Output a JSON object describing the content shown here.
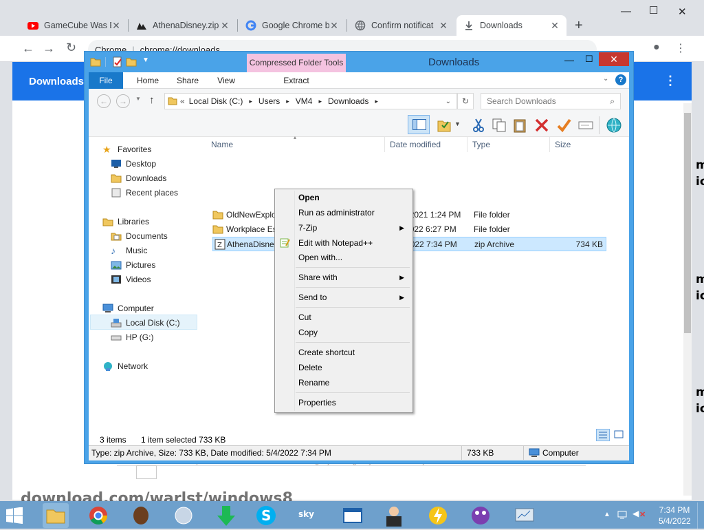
{
  "chrome": {
    "tabs": [
      {
        "label": "GameCube Was B",
        "favicon": "youtube-icon"
      },
      {
        "label": "AthenaDisney.zip",
        "favicon": "mediafire-icon"
      },
      {
        "label": "Google Chrome b",
        "favicon": "google-icon"
      },
      {
        "label": "Confirm notificat",
        "favicon": "globe-icon"
      },
      {
        "label": "Downloads",
        "favicon": "download-icon"
      }
    ],
    "close_glyph": "✕",
    "new_tab_glyph": "+",
    "omnibox_prefix": "Chrome",
    "omnibox_url": "chrome://downloads",
    "page_title": "Downloads",
    "page_url_fragment": "https://download1070.mediafire.com/cg43jmeo4dg/8.8jz8wnvdsd/NotifyFault-r...",
    "side_text": [
      "m",
      "ic",
      "m",
      "ic",
      "m",
      "ic"
    ],
    "colors": {
      "accent": "#1a73e8"
    }
  },
  "explorer": {
    "title": "Downloads",
    "contextual_tab_group": "Compressed Folder Tools",
    "ribbon_tabs": [
      "File",
      "Home",
      "Share",
      "View",
      "Extract"
    ],
    "breadcrumb": [
      "Local Disk (C:)",
      "Users",
      "VM4",
      "Downloads"
    ],
    "breadcrumb_overflow": "«",
    "search_placeholder": "Search Downloads",
    "columns": [
      "Name",
      "Date modified",
      "Type",
      "Size"
    ],
    "nav": {
      "favorites": "Favorites",
      "favorites_items": [
        "Desktop",
        "Downloads",
        "Recent places"
      ],
      "libraries": "Libraries",
      "libraries_items": [
        "Documents",
        "Music",
        "Pictures",
        "Videos"
      ],
      "computer": "Computer",
      "computer_items": [
        "Local Disk (C:)",
        "HP (G:)"
      ],
      "network": "Network"
    },
    "files": [
      {
        "name": "OldNewExplorer",
        "date": "2/26/2021 1:24 PM",
        "type": "File folder",
        "size": ""
      },
      {
        "name": "Workplace Essentials - April 2022",
        "date": "5/4/2022 6:27 PM",
        "type": "File folder",
        "size": ""
      },
      {
        "name": "AthenaDisney",
        "date": "5/4/2022 7:34 PM",
        "type": "zip Archive",
        "size": "734 KB"
      }
    ],
    "status": {
      "count": "3 items",
      "selected": "1 item selected  733 KB"
    },
    "details": {
      "info": "Type: zip Archive, Size: 733 KB, Date modified: 5/4/2022 7:34 PM",
      "size": "733 KB",
      "location": "Computer"
    }
  },
  "context_menu": {
    "items": [
      "Open",
      "Run as administrator",
      "7-Zip",
      "Edit with Notepad++",
      "Open with...",
      "Share with",
      "Send to",
      "Cut",
      "Copy",
      "Create shortcut",
      "Delete",
      "Rename",
      "Properties"
    ]
  },
  "taskbar": {
    "time": "7:34 PM",
    "date": "5/4/2022",
    "watermark": "download.com/warlst/windows8"
  }
}
